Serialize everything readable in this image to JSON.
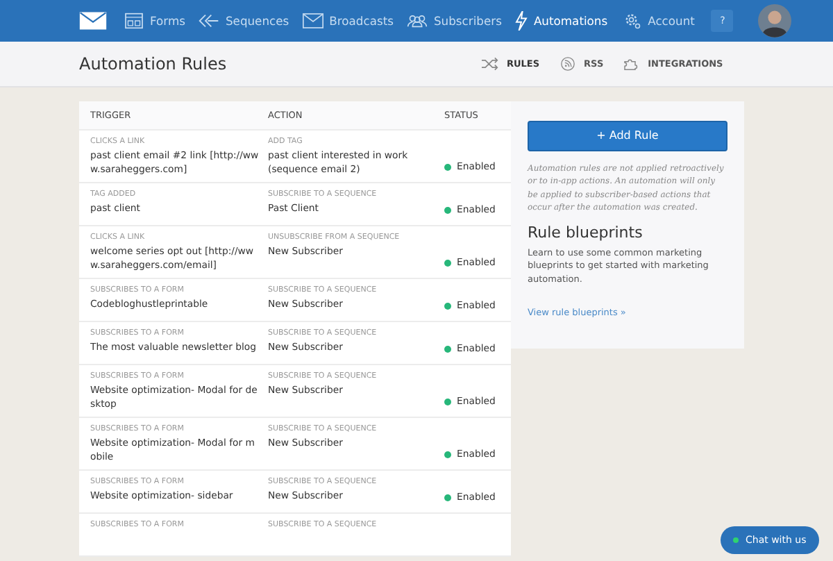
{
  "nav": {
    "items": [
      {
        "label": "Forms",
        "kind": "form",
        "selected": false
      },
      {
        "label": "Sequences",
        "kind": "sequence",
        "selected": false
      },
      {
        "label": "Broadcasts",
        "kind": "mail",
        "selected": false
      },
      {
        "label": "Subscribers",
        "kind": "people",
        "selected": false
      },
      {
        "label": "Automations",
        "kind": "bolt",
        "selected": true
      },
      {
        "label": "Account",
        "kind": "gear",
        "selected": false
      }
    ],
    "help": "?"
  },
  "page_title": "Automation Rules",
  "subtabs": [
    {
      "label": "RULES",
      "kind": "shuffle",
      "selected": true
    },
    {
      "label": "RSS",
      "kind": "rss",
      "selected": false
    },
    {
      "label": "INTEGRATIONS",
      "kind": "puzzle",
      "selected": false
    }
  ],
  "table": {
    "columns": [
      "TRIGGER",
      "ACTION",
      "STATUS"
    ],
    "rows": [
      {
        "trigger_type": "CLICKS A LINK",
        "trigger": "past client email #2 link [http://www.saraheggers.com]",
        "action_type": "ADD TAG",
        "action": "past client interested in work (sequence email 2)",
        "status": "Enabled",
        "enabled": true
      },
      {
        "trigger_type": "TAG ADDED",
        "trigger": "past client",
        "action_type": "SUBSCRIBE TO A SEQUENCE",
        "action": "Past Client",
        "status": "Enabled",
        "enabled": true
      },
      {
        "trigger_type": "CLICKS A LINK",
        "trigger": "welcome series opt out [http://www.saraheggers.com/email]",
        "action_type": "UNSUBSCRIBE FROM A SEQUENCE",
        "action": "New Subscriber",
        "status": "Enabled",
        "enabled": true
      },
      {
        "trigger_type": "SUBSCRIBES TO A FORM",
        "trigger": "Codebloghustleprintable",
        "action_type": "SUBSCRIBE TO A SEQUENCE",
        "action": "New Subscriber",
        "status": "Enabled",
        "enabled": true
      },
      {
        "trigger_type": "SUBSCRIBES TO A FORM",
        "trigger": "The most valuable newsletter blog",
        "action_type": "SUBSCRIBE TO A SEQUENCE",
        "action": "New Subscriber",
        "status": "Enabled",
        "enabled": true
      },
      {
        "trigger_type": "SUBSCRIBES TO A FORM",
        "trigger": "Website optimization- Modal for desktop",
        "action_type": "SUBSCRIBE TO A SEQUENCE",
        "action": "New Subscriber",
        "status": "Enabled",
        "enabled": true
      },
      {
        "trigger_type": "SUBSCRIBES TO A FORM",
        "trigger": "Website optimization- Modal for mobile",
        "action_type": "SUBSCRIBE TO A SEQUENCE",
        "action": "New Subscriber",
        "status": "Enabled",
        "enabled": true
      },
      {
        "trigger_type": "SUBSCRIBES TO A FORM",
        "trigger": "Website optimization- sidebar",
        "action_type": "SUBSCRIBE TO A SEQUENCE",
        "action": "New Subscriber",
        "status": "Enabled",
        "enabled": true
      },
      {
        "trigger_type": "SUBSCRIBES TO A FORM",
        "action_type": "SUBSCRIBE TO A SEQUENCE"
      }
    ]
  },
  "sidebar": {
    "button": "+ Add Rule",
    "note": "Automation rules are not applied retroactively or to in-app actions. An automation will only be applied to subscriber-based actions that occur after the automation was created.",
    "heading": "Rule blueprints",
    "text": "Learn to use some common marketing blueprints to get started with marketing automation.",
    "link": "View rule blueprints »"
  },
  "chat": {
    "label": "Chat with us",
    "online": true
  }
}
